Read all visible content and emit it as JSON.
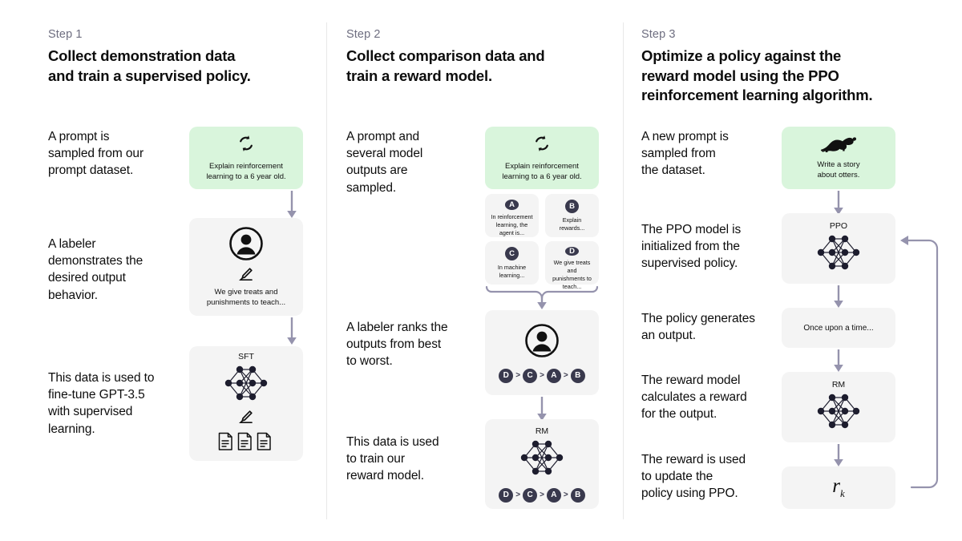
{
  "palette": {
    "background": "#ffffff",
    "box_gray": "#f4f4f4",
    "box_green": "#d9f5dc",
    "arrow": "#9593ad",
    "badge": "#39394d",
    "divider": "#e8e8e8",
    "text": "#0d0d0d",
    "muted_text": "#6e6e80"
  },
  "steps": [
    {
      "label": "Step 1",
      "title": "Collect demonstration data\nand train a supervised policy.",
      "descriptions": [
        "A prompt is\nsampled from our\nprompt dataset.",
        "A labeler\ndemonstrates the\ndesired output\nbehavior.",
        "This data is used to\nfine-tune GPT-3.5\nwith supervised\nlearning."
      ],
      "boxes": [
        {
          "icon": "refresh-cycle-icon",
          "text": "Explain reinforcement\nlearning to a 6 year old.",
          "style": "green"
        },
        {
          "icon": "person-circle-icon",
          "sub_icon": "pencil-icon",
          "text": "We give treats and\npunishments to teach...",
          "style": "gray"
        },
        {
          "label": "SFT",
          "icon": "neural-network-icon",
          "sub_icon": "pencil-icon",
          "extra_icon": "documents-icon",
          "style": "gray"
        }
      ]
    },
    {
      "label": "Step 2",
      "title": "Collect comparison data and\ntrain a reward model.",
      "descriptions": [
        "A prompt and\nseveral model\noutputs are\nsampled.",
        "A labeler ranks the\noutputs from best\nto worst.",
        "This data is used\nto train our\nreward model."
      ],
      "prompt_box": {
        "icon": "refresh-cycle-icon",
        "text": "Explain reinforcement\nlearning to a 6 year old.",
        "style": "green"
      },
      "options": [
        {
          "badge": "A",
          "text": "In reinforcement\nlearning, the\nagent is..."
        },
        {
          "badge": "B",
          "text": "Explain rewards..."
        },
        {
          "badge": "C",
          "text": "In machine\nlearning..."
        },
        {
          "badge": "D",
          "text": "We give treats and\npunishments to\nteach..."
        }
      ],
      "labeler_box": {
        "icon": "person-circle-icon",
        "ranking": [
          "D",
          "C",
          "A",
          "B"
        ]
      },
      "rm_box": {
        "label": "RM",
        "icon": "neural-network-icon",
        "ranking": [
          "D",
          "C",
          "A",
          "B"
        ]
      }
    },
    {
      "label": "Step 3",
      "title": "Optimize a policy against the\nreward model using the PPO\nreinforcement learning algorithm.",
      "descriptions": [
        "A new prompt is\nsampled from\nthe dataset.",
        "The PPO model is\ninitialized from the\nsupervised policy.",
        "The policy generates\nan output.",
        "The reward model\ncalculates a reward\nfor the output.",
        "The reward is used\nto update the\npolicy using PPO."
      ],
      "boxes": [
        {
          "icon": "otter-icon",
          "text": "Write a story\nabout otters.",
          "style": "green"
        },
        {
          "label": "PPO",
          "icon": "neural-network-icon",
          "style": "gray"
        },
        {
          "text": "Once upon a time...",
          "style": "gray"
        },
        {
          "label": "RM",
          "icon": "neural-network-icon",
          "style": "gray"
        },
        {
          "text": "r_k",
          "style": "gray",
          "math": {
            "base": "r",
            "sub": "k"
          }
        }
      ],
      "feedback_loop": "reward feeds back into PPO model"
    }
  ]
}
